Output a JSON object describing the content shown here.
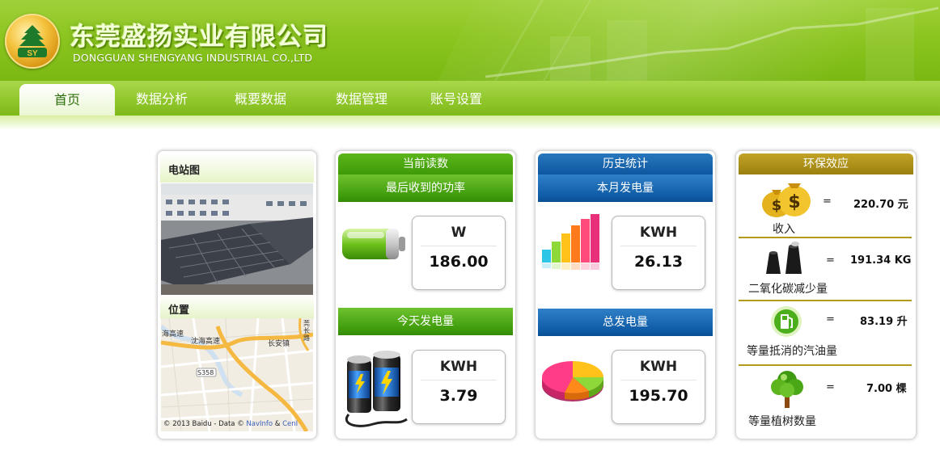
{
  "header": {
    "company_cn": "东莞盛扬实业有限公司",
    "company_en": "DONGGUAN SHENGYANG INDUSTRIAL CO.,LTD",
    "logo_text": "SY"
  },
  "nav": {
    "items": [
      {
        "label": "首页"
      },
      {
        "label": "数据分析"
      },
      {
        "label": "概要数据"
      },
      {
        "label": "数据管理"
      },
      {
        "label": "账号设置"
      }
    ]
  },
  "station": {
    "title": "电站图",
    "location_title": "位置",
    "map": {
      "labels": [
        "海高速",
        "沈海高速",
        "长安镇",
        "S358",
        "莞长路"
      ],
      "copyright_prefix": "© 2013 Baidu - Data © ",
      "copyright_link1": "NavInfo",
      "copyright_amp": " & ",
      "copyright_link2": "CenI"
    }
  },
  "current": {
    "header": "当前读数",
    "power_title": "最后收到的功率",
    "power_unit": "W",
    "power_value": "186.00",
    "today_title": "今天发电量",
    "today_unit": "KWH",
    "today_value": "3.79"
  },
  "history": {
    "header": "历史统计",
    "month_title": "本月发电量",
    "month_unit": "KWH",
    "month_value": "26.13",
    "total_title": "总发电量",
    "total_unit": "KWH",
    "total_value": "195.70"
  },
  "eco": {
    "header": "环保效应",
    "rows": [
      {
        "icon": "money-bags-icon",
        "eq": "=",
        "amount": "220.70 元",
        "label": "收入"
      },
      {
        "icon": "factory-chimney-icon",
        "eq": "=",
        "amount": "191.34 KG",
        "label": "二氧化碳减少量"
      },
      {
        "icon": "fuel-pump-icon",
        "eq": "=",
        "amount": "83.19 升",
        "label": "等量抵消的汽油量"
      },
      {
        "icon": "tree-icon",
        "eq": "=",
        "amount": "7.00 棵",
        "label": "等量植树数量"
      }
    ]
  },
  "colors": {
    "brand_green": "#8cc520",
    "panel_blue": "#0d57a0",
    "eco_gold": "#9a800f"
  }
}
